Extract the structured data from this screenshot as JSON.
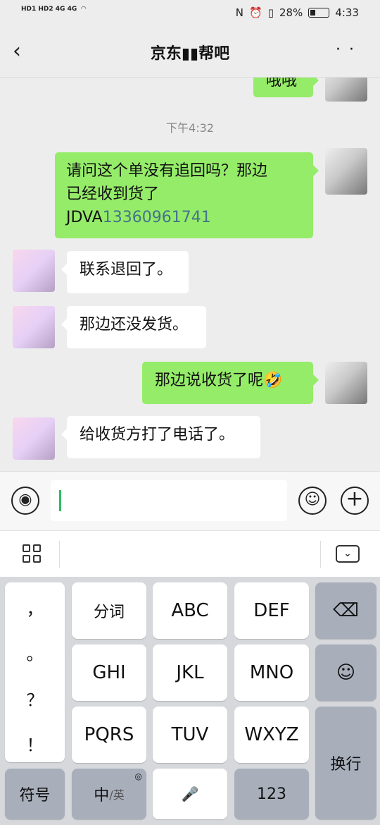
{
  "status": {
    "left": "HD1 HD2 4G 4G",
    "battery": "28%",
    "time": "4:33"
  },
  "header": {
    "title": "京东▮▮帮吧",
    "back": "‹",
    "more": "··"
  },
  "messages": {
    "prev_text": "哦哦",
    "time": "下午4:32",
    "m1_a": "请问这个单没有追回吗？那边",
    "m1_b": "已经收到货了",
    "m1_c1": "JDVA",
    "m1_c2": "13360961741",
    "m2": "联系退回了。",
    "m3": "那边还没发货。",
    "m4": "那边说收货了呢",
    "m4_emoji": "🤣",
    "m5": "给收货方打了电话了。"
  },
  "input": {
    "value": ""
  },
  "keyboard": {
    "punct": [
      "，",
      "。",
      "？",
      "！"
    ],
    "rows": [
      [
        "分词",
        "ABC",
        "DEF"
      ],
      [
        "GHI",
        "JKL",
        "MNO"
      ],
      [
        "PQRS",
        "TUV",
        "WXYZ"
      ]
    ],
    "bottom": {
      "symbols": "符号",
      "zh": "中",
      "en": "/英",
      "num": "123",
      "enter": "换行"
    }
  }
}
